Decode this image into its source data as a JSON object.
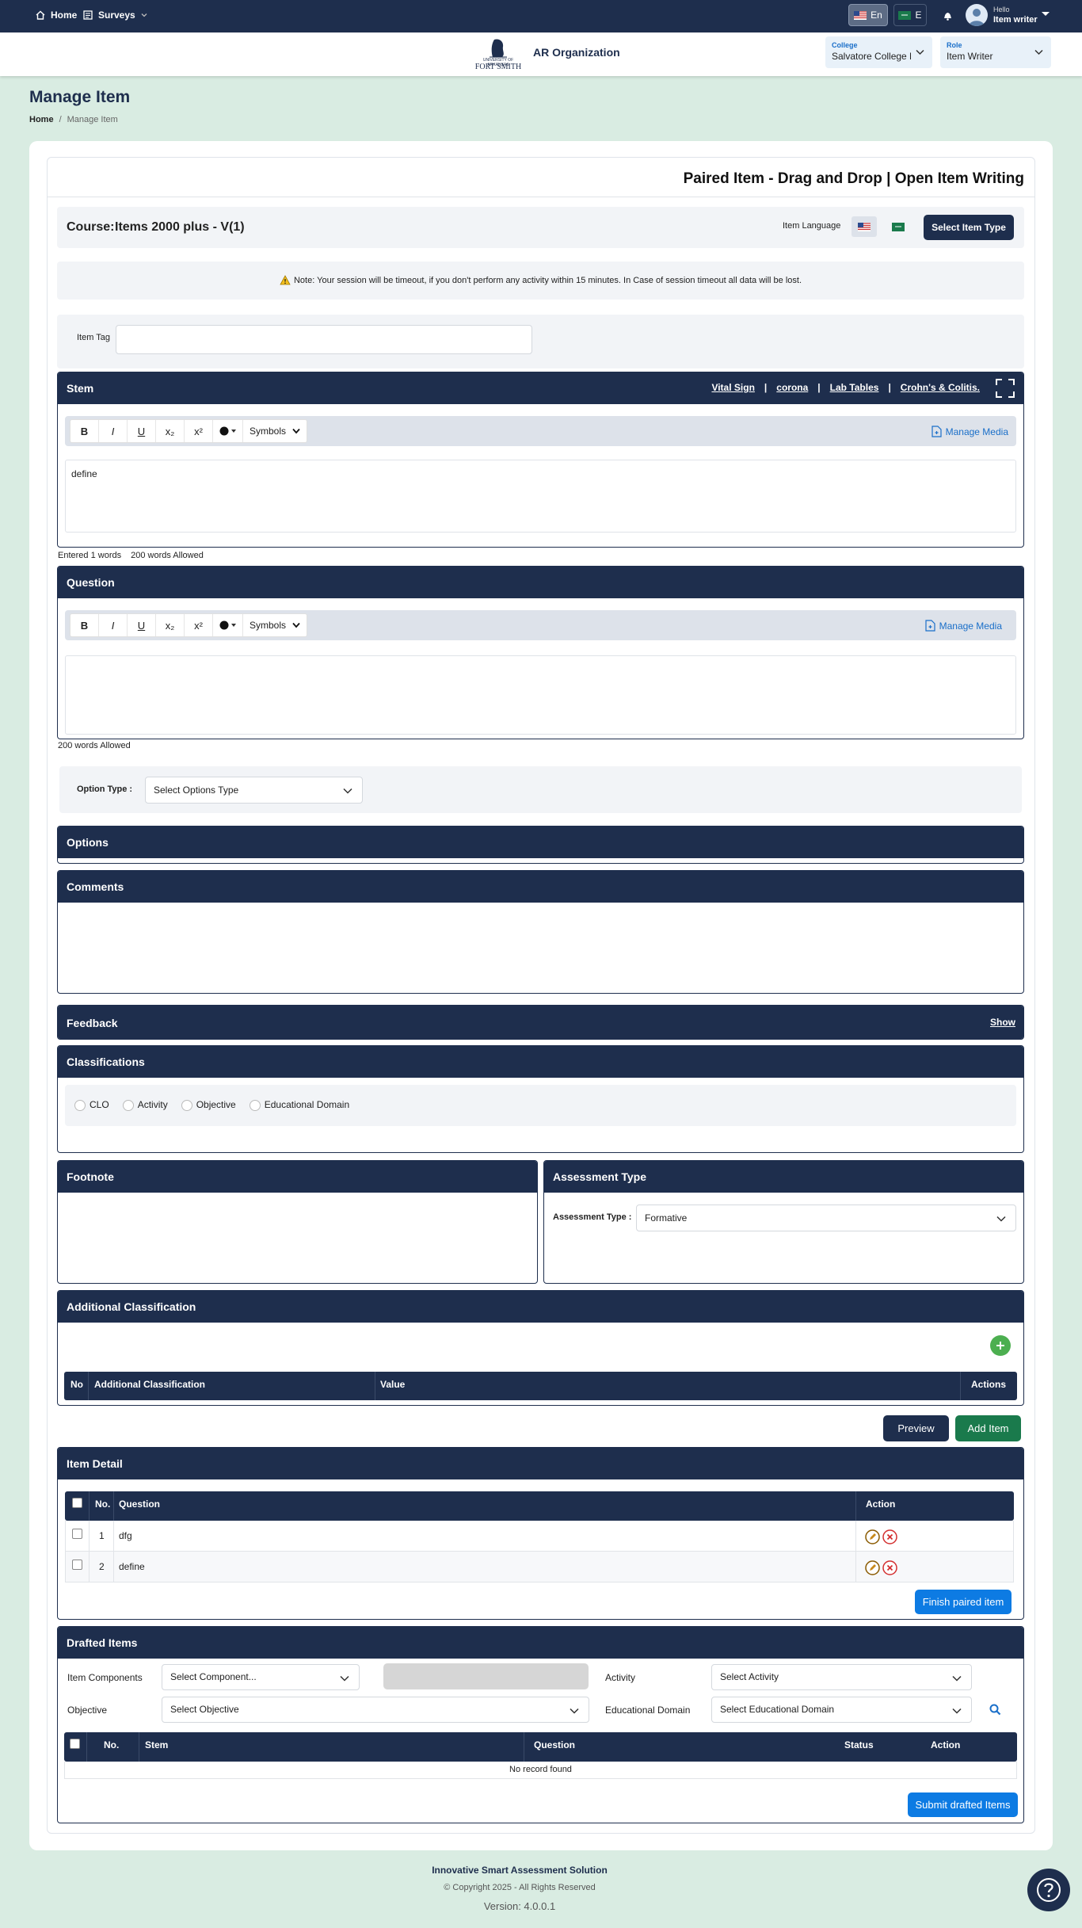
{
  "nav": {
    "home": "Home",
    "surveys": "Surveys",
    "lang_en": "En",
    "lang_ar": "E",
    "hello": "Hello",
    "user": "Item writer"
  },
  "header": {
    "logo_top": "UNIVERSITY OF ARKANSAS",
    "logo_bottom": "FORT SMITH",
    "org": "AR Organization",
    "college_label": "College",
    "college_value": "Salvatore College M",
    "role_label": "Role",
    "role_value": "Item Writer"
  },
  "page": {
    "title": "Manage Item",
    "breadcrumb_home": "Home",
    "breadcrumb_sep": "/",
    "breadcrumb_current": "Manage Item",
    "item_heading": "Paired Item - Drag and Drop | Open Item Writing",
    "course_label": "Course:",
    "course_value": "Items 2000 plus - V(1)",
    "item_language": "Item Language",
    "select_item_type": "Select Item Type",
    "note": "Note: Your session will be timeout, if you don't perform any activity within 15 minutes. In Case of session timeout all data will be lost.",
    "item_tag": "Item Tag"
  },
  "stem": {
    "title": "Stem",
    "links": [
      "Vital Sign",
      "|",
      "corona",
      "|",
      "Lab Tables",
      "|",
      "Crohn's & Colitis."
    ],
    "toolbar": [
      "B",
      "I",
      "U",
      "x₂",
      "x²"
    ],
    "symbols": "Symbols",
    "manage_media": "Manage Media",
    "content": "define",
    "entered": "Entered 1 words",
    "allowed": "200 words Allowed"
  },
  "question": {
    "title": "Question",
    "toolbar": [
      "B",
      "I",
      "U",
      "x₂",
      "x²"
    ],
    "symbols": "Symbols",
    "manage_media": "Manage Media",
    "allowed": "200 words Allowed"
  },
  "option_type": {
    "label": "Option Type :",
    "value": "Select Options Type"
  },
  "options": {
    "title": "Options"
  },
  "comments": {
    "title": "Comments"
  },
  "feedback": {
    "title": "Feedback",
    "show": "Show"
  },
  "classifications": {
    "title": "Classifications",
    "items": [
      "CLO",
      "Activity",
      "Objective",
      "Educational Domain"
    ]
  },
  "footnote": {
    "title": "Footnote"
  },
  "assessment": {
    "title": "Assessment Type",
    "label": "Assessment Type :",
    "value": "Formative"
  },
  "additional": {
    "title": "Additional Classification",
    "columns": [
      "No",
      "Additional Classification",
      "Value",
      "Actions"
    ]
  },
  "actions": {
    "preview": "Preview",
    "add_item": "Add Item"
  },
  "item_detail": {
    "title": "Item Detail",
    "columns": [
      "No.",
      "Question",
      "Action"
    ],
    "rows": [
      {
        "no": "1",
        "question": "dfg"
      },
      {
        "no": "2",
        "question": "define"
      }
    ],
    "finish": "Finish paired item"
  },
  "drafted": {
    "title": "Drafted Items",
    "item_components_label": "Item Components",
    "item_components_value": "Select Component...",
    "activity_label": "Activity",
    "activity_value": "Select Activity",
    "objective_label": "Objective",
    "objective_value": "Select Objective",
    "edu_label": "Educational Domain",
    "edu_value": "Select Educational Domain",
    "columns": [
      "No.",
      "Stem",
      "Question",
      "Status",
      "Action"
    ],
    "empty": "No record found",
    "submit": "Submit drafted Items"
  },
  "footer": {
    "title": "Innovative Smart Assessment Solution",
    "copyright": "© Copyright 2025 - All Rights Reserved",
    "version": "Version: 4.0.0.1"
  },
  "colors": {
    "navy": "#1e2e4d",
    "green": "#1a7a4c",
    "blue": "#0d7be3",
    "background": "#d9ece2"
  }
}
